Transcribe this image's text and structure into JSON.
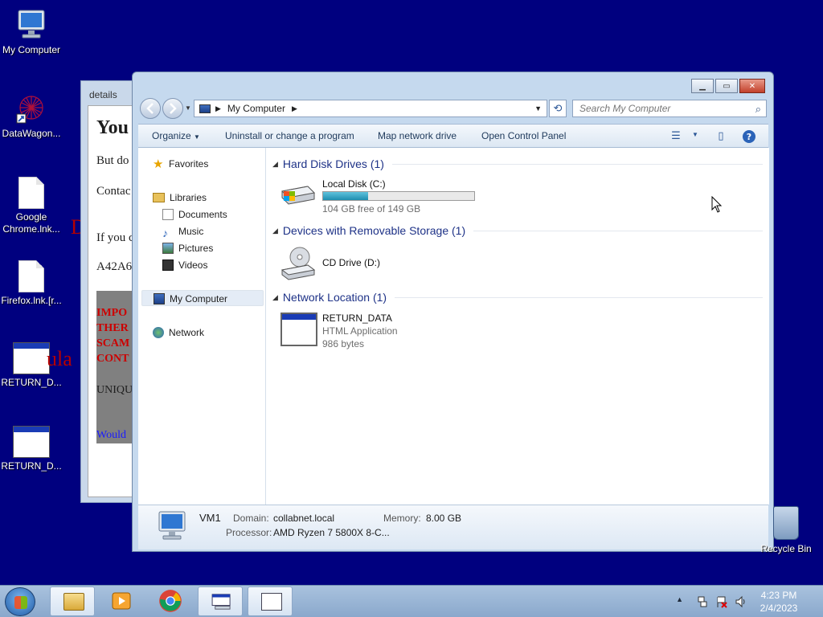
{
  "desktop": {
    "icons": [
      {
        "label": "My Computer"
      },
      {
        "label": "DataWagon..."
      },
      {
        "label": "Google Chrome.lnk..."
      },
      {
        "label": "Firefox.lnk.[r..."
      },
      {
        "label": "RETURN_D..."
      },
      {
        "label": "RETURN_D..."
      }
    ],
    "recycle_bin": "Recycle Bin",
    "background_fragments": {
      "left_d": "D",
      "left_ula": "ula"
    }
  },
  "details_window": {
    "title": "details",
    "lines": [
      "You",
      "But do",
      "Contac",
      "If you c",
      "A42A6",
      "IMPO",
      "THER",
      "SCAM",
      "CONT",
      "UNIQU",
      "Would"
    ]
  },
  "explorer": {
    "address": {
      "location": "My Computer"
    },
    "search": {
      "placeholder": "Search My Computer"
    },
    "toolbar": {
      "organize": "Organize",
      "uninstall": "Uninstall or change a program",
      "map_drive": "Map network drive",
      "control_panel": "Open Control Panel"
    },
    "nav": {
      "favorites": "Favorites",
      "libraries": "Libraries",
      "documents": "Documents",
      "music": "Music",
      "pictures": "Pictures",
      "videos": "Videos",
      "my_computer": "My Computer",
      "network": "Network"
    },
    "groups": {
      "hdd": {
        "title": "Hard Disk Drives (1)",
        "drive": "Local Disk (C:)",
        "free": "104 GB free of 149 GB",
        "used_fraction": 0.3
      },
      "removable": {
        "title": "Devices with Removable Storage (1)",
        "drive": "CD Drive (D:)"
      },
      "network": {
        "title": "Network Location (1)",
        "name": "RETURN_DATA",
        "type": "HTML Application",
        "size": "986 bytes"
      }
    },
    "details": {
      "computer_name": "VM1",
      "domain_label": "Domain:",
      "domain_value": "collabnet.local",
      "memory_label": "Memory:",
      "memory_value": "8.00 GB",
      "processor_label": "Processor:",
      "processor_value": "AMD Ryzen 7 5800X 8-C..."
    }
  },
  "taskbar": {
    "time": "4:23 PM",
    "date": "2/4/2023"
  },
  "colors": {
    "desktop": "#00007f",
    "link_blue": "#1e3287",
    "accent_bar": "#1e8eb0"
  }
}
